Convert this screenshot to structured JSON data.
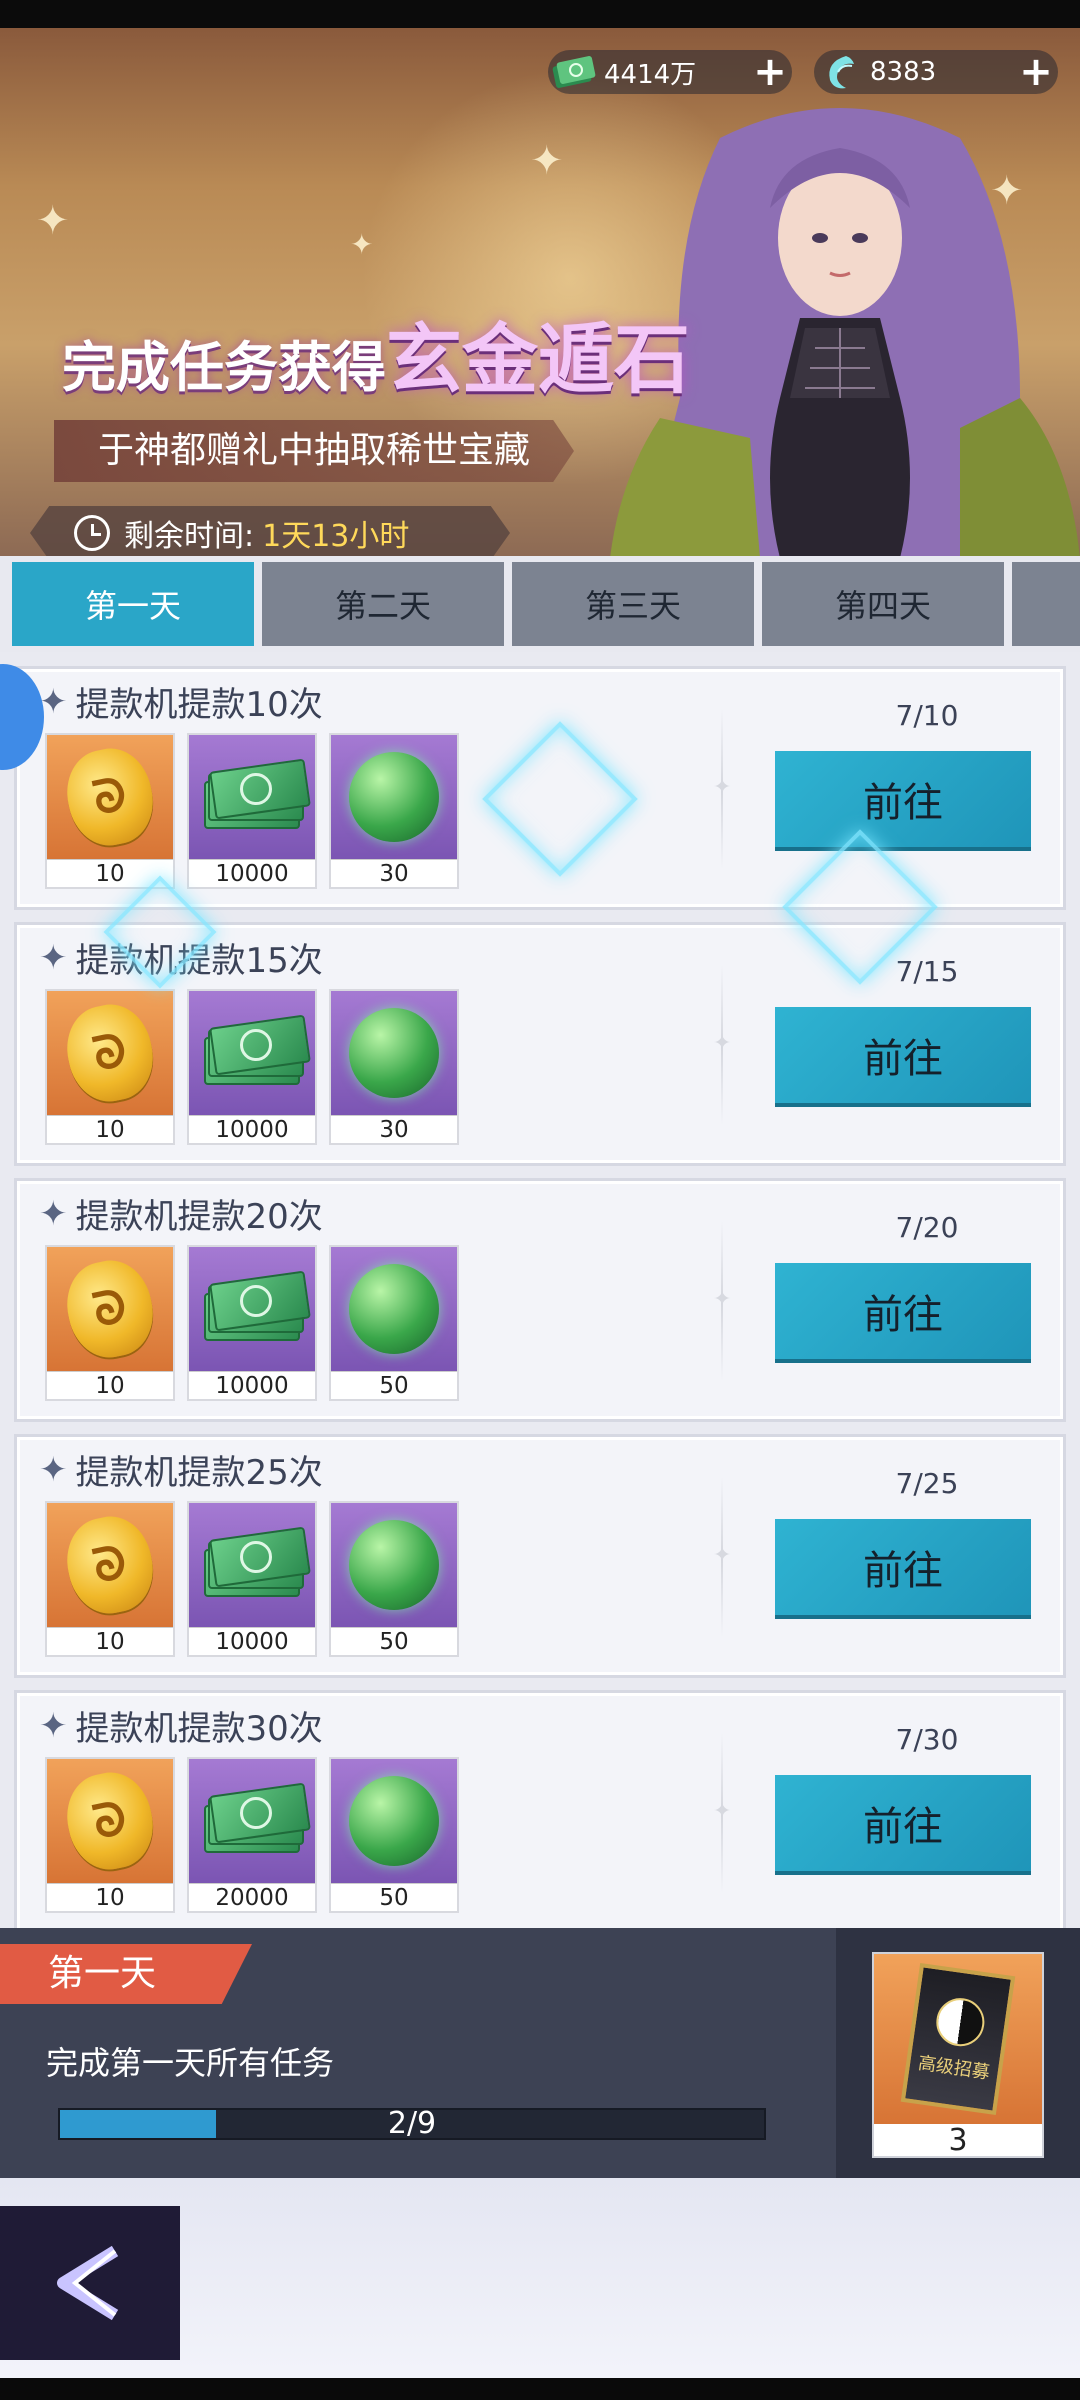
{
  "currencies": [
    {
      "icon": "cash-icon",
      "value": "4414万"
    },
    {
      "icon": "gem-icon",
      "value": "8383"
    }
  ],
  "banner": {
    "title_prefix": "完成任务获得",
    "title_highlight": "玄金遁石",
    "subtitle": "于神都赠礼中抽取稀世宝藏",
    "timer_label": "剩余时间:",
    "timer_value": "1天13小时"
  },
  "tabs": [
    {
      "label": "第一天",
      "active": true
    },
    {
      "label": "第二天",
      "active": false
    },
    {
      "label": "第三天",
      "active": false
    },
    {
      "label": "第四天",
      "active": false
    }
  ],
  "tasks": [
    {
      "name": "提款机提款10次",
      "progress": "7/10",
      "button": "前往",
      "rewards": [
        "10",
        "10000",
        "30"
      ]
    },
    {
      "name": "提款机提款15次",
      "progress": "7/15",
      "button": "前往",
      "rewards": [
        "10",
        "10000",
        "30"
      ]
    },
    {
      "name": "提款机提款20次",
      "progress": "7/20",
      "button": "前往",
      "rewards": [
        "10",
        "10000",
        "50"
      ]
    },
    {
      "name": "提款机提款25次",
      "progress": "7/25",
      "button": "前往",
      "rewards": [
        "10",
        "10000",
        "50"
      ]
    },
    {
      "name": "提款机提款30次",
      "progress": "7/30",
      "button": "前往",
      "rewards": [
        "10",
        "20000",
        "50"
      ]
    }
  ],
  "reward_icons": [
    "gold-coin-icon",
    "cash-stack-icon",
    "green-orb-icon"
  ],
  "bottom": {
    "day_label": "第一天",
    "description": "完成第一天所有任务",
    "progress_text": "2/9",
    "progress_fraction": 0.2222,
    "chest_card_text": "高级招募",
    "chest_count": "3"
  },
  "colors": {
    "tab_active": "#2aa6c8",
    "go_button": "#2fb3d2",
    "day_label": "#e15b44",
    "progress_fill": "#2f9ad0"
  }
}
